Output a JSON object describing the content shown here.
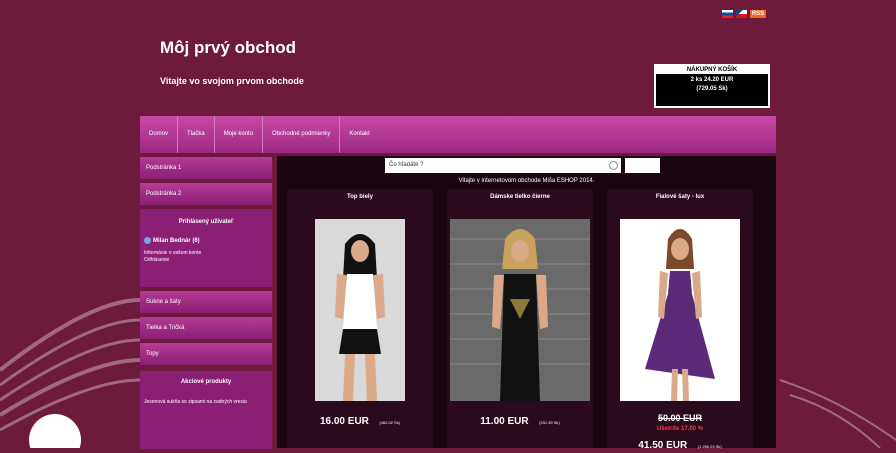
{
  "header": {
    "title": "Môj prvý obchod",
    "subtitle": "Vitajte vo svojom prvom obchode",
    "flags": [
      "slovak-flag-icon",
      "czech-flag-icon",
      "rss-icon"
    ],
    "rss_label": "RSS"
  },
  "cart": {
    "header": "NÁKUPNÝ KOŠÍK",
    "line1": "2 ks 24.20 EUR",
    "line2": "(729.05 Sk)"
  },
  "nav": {
    "items": [
      "Domov",
      "Tlačka",
      "Moje konto",
      "Obchodné podmienky",
      "Kontakt"
    ]
  },
  "sidebar": {
    "pages": [
      "Podstránka 1",
      "Podstránka 2"
    ],
    "login": {
      "title": "Prihlásený užívateľ",
      "user": "Milan Bednár (6)",
      "account_link": "Informácie o vašom konte",
      "logout_link": "Odhlásenie"
    },
    "categories": [
      "Sukne a šaty",
      "Tielka a Tričká",
      "Topy"
    ],
    "promo": {
      "title": "Akciové produkty",
      "text": "Jesenová sukňa so zipsami na zadných vrecia"
    }
  },
  "main": {
    "search_placeholder": "Čo hľadáte ?",
    "welcome": "Vitajte v internetovom obchode Miša ESHOP 2014.",
    "products": [
      {
        "name": "Top biely",
        "price": "16.00 EUR",
        "alt_price": "(482.02 Sk)"
      },
      {
        "name": "Dámske tielko čierne",
        "price": "11.00 EUR",
        "alt_price": "(331.39 Sk)"
      },
      {
        "name": "Fialové šaty - lux",
        "old_price": "50.00 EUR",
        "discount": "Ušetríte 17.00 %",
        "price": "41.50 EUR",
        "alt_price": "(1 250.23 Sk)"
      }
    ]
  },
  "colors": {
    "background": "#6d1a3d",
    "nav": "#b53b96",
    "discount": "#ff3b3b"
  }
}
